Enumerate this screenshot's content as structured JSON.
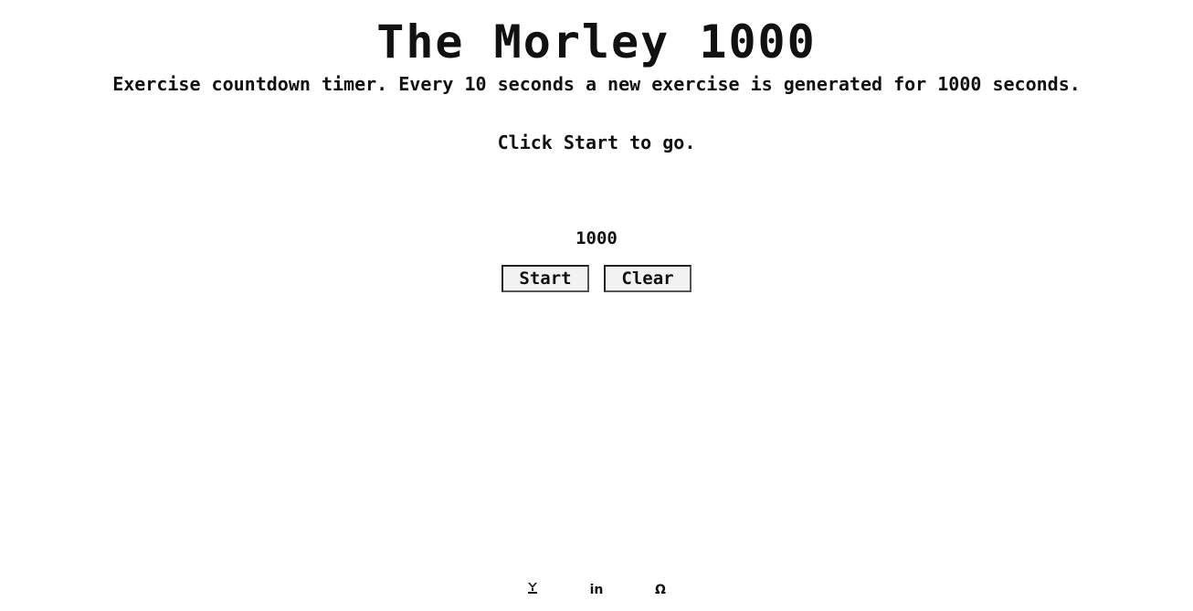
{
  "header": {
    "title": "The Morley 1000",
    "subtitle": "Exercise countdown timer. Every 10 seconds a new exercise is generated for 1000 seconds.",
    "instruction": "Click Start to go."
  },
  "timer": {
    "value": "1000"
  },
  "controls": {
    "start_label": "Start",
    "clear_label": "Clear"
  },
  "social": {
    "twitter_glyph": "𝕪",
    "linkedin_glyph": "in",
    "github_glyph": "Ω",
    "icons": [
      "twitter-icon",
      "linkedin-icon",
      "github-icon"
    ]
  }
}
